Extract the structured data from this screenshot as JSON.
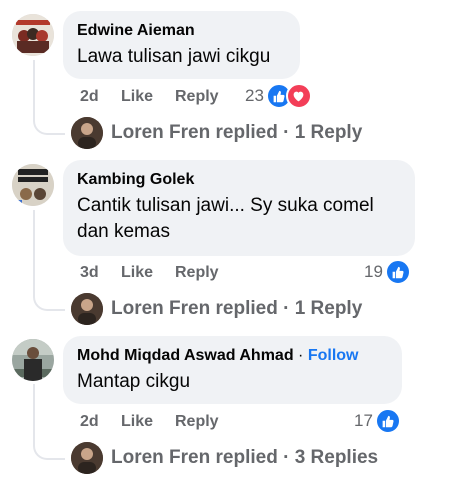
{
  "comments": [
    {
      "author": "Edwine Aieman",
      "text": "Lawa tulisan jawi cikgu",
      "time": "2d",
      "like_label": "Like",
      "reply_label": "Reply",
      "reaction_count": "23",
      "reactions": [
        "like-icon",
        "love-icon"
      ],
      "replies_link": "Loren Fren replied · 1 Reply"
    },
    {
      "author": "Kambing Golek",
      "text": "Cantik tulisan jawi... Sy suka comel dan kemas",
      "time": "3d",
      "like_label": "Like",
      "reply_label": "Reply",
      "reaction_count": "19",
      "reactions": [
        "like-icon"
      ],
      "replies_link": "Loren Fren replied · 1 Reply"
    },
    {
      "author": "Mohd Miqdad Aswad Ahmad",
      "follow_label": "Follow",
      "separator": "·",
      "text": "Mantap cikgu",
      "time": "2d",
      "like_label": "Like",
      "reply_label": "Reply",
      "reaction_count": "17",
      "reactions": [
        "like-icon"
      ],
      "replies_link": "Loren Fren replied · 3 Replies"
    }
  ],
  "colors": {
    "bubble": "#f0f2f5",
    "meta_text": "#65676b",
    "accent_blue": "#1877f2",
    "love_red": "#f33e58"
  }
}
